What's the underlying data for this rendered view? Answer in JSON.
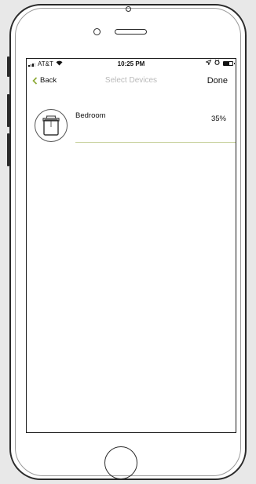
{
  "status_bar": {
    "carrier": "AT&T",
    "time": "10:25 PM",
    "battery_level": 0.6,
    "icons": [
      "signal-icon",
      "wifi-icon",
      "location-icon",
      "alarm-icon",
      "battery-icon"
    ]
  },
  "nav": {
    "back_label": "Back",
    "title": "Select Devices",
    "done_label": "Done"
  },
  "devices": [
    {
      "name": "Bedroom",
      "level": "35%",
      "icon": "window-shade-icon"
    }
  ],
  "colors": {
    "divider": "#c9d3a0",
    "title_gray": "#b9b9b9",
    "frame": "#2a2a2a"
  }
}
